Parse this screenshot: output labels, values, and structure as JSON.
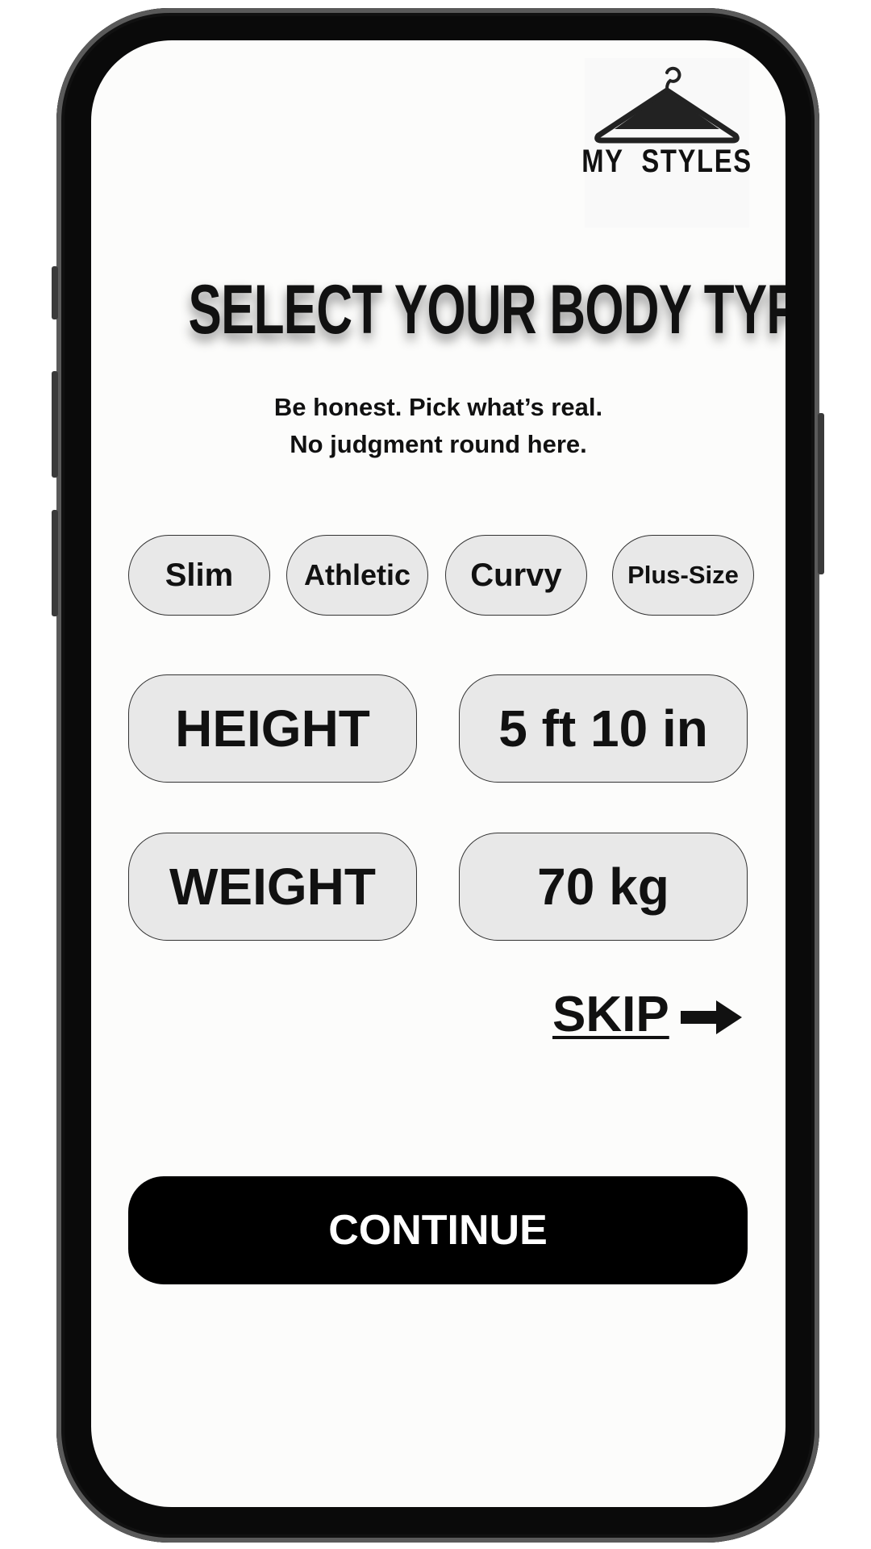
{
  "app": {
    "logo_text": "MY STYLES",
    "logo_icon": "hanger-icon"
  },
  "header": {
    "title": "SELECT YOUR BODY TYPE",
    "subtitle_line1": "Be honest. Pick what’s real.",
    "subtitle_line2": "No judgment round here."
  },
  "body_types": [
    {
      "label": "Slim"
    },
    {
      "label": "Athletic"
    },
    {
      "label": "Curvy"
    },
    {
      "label": "Plus-Size"
    }
  ],
  "measurements": {
    "height_label": "HEIGHT",
    "height_value": "5 ft 10 in",
    "weight_label": "WEIGHT",
    "weight_value": "70 kg"
  },
  "actions": {
    "skip_label": "SKIP",
    "skip_icon": "arrow-right-icon",
    "continue_label": "CONTINUE"
  },
  "colors": {
    "background": "#fcfcfb",
    "chip_fill": "#e8e8e8",
    "button": "#000000",
    "text": "#111111"
  }
}
